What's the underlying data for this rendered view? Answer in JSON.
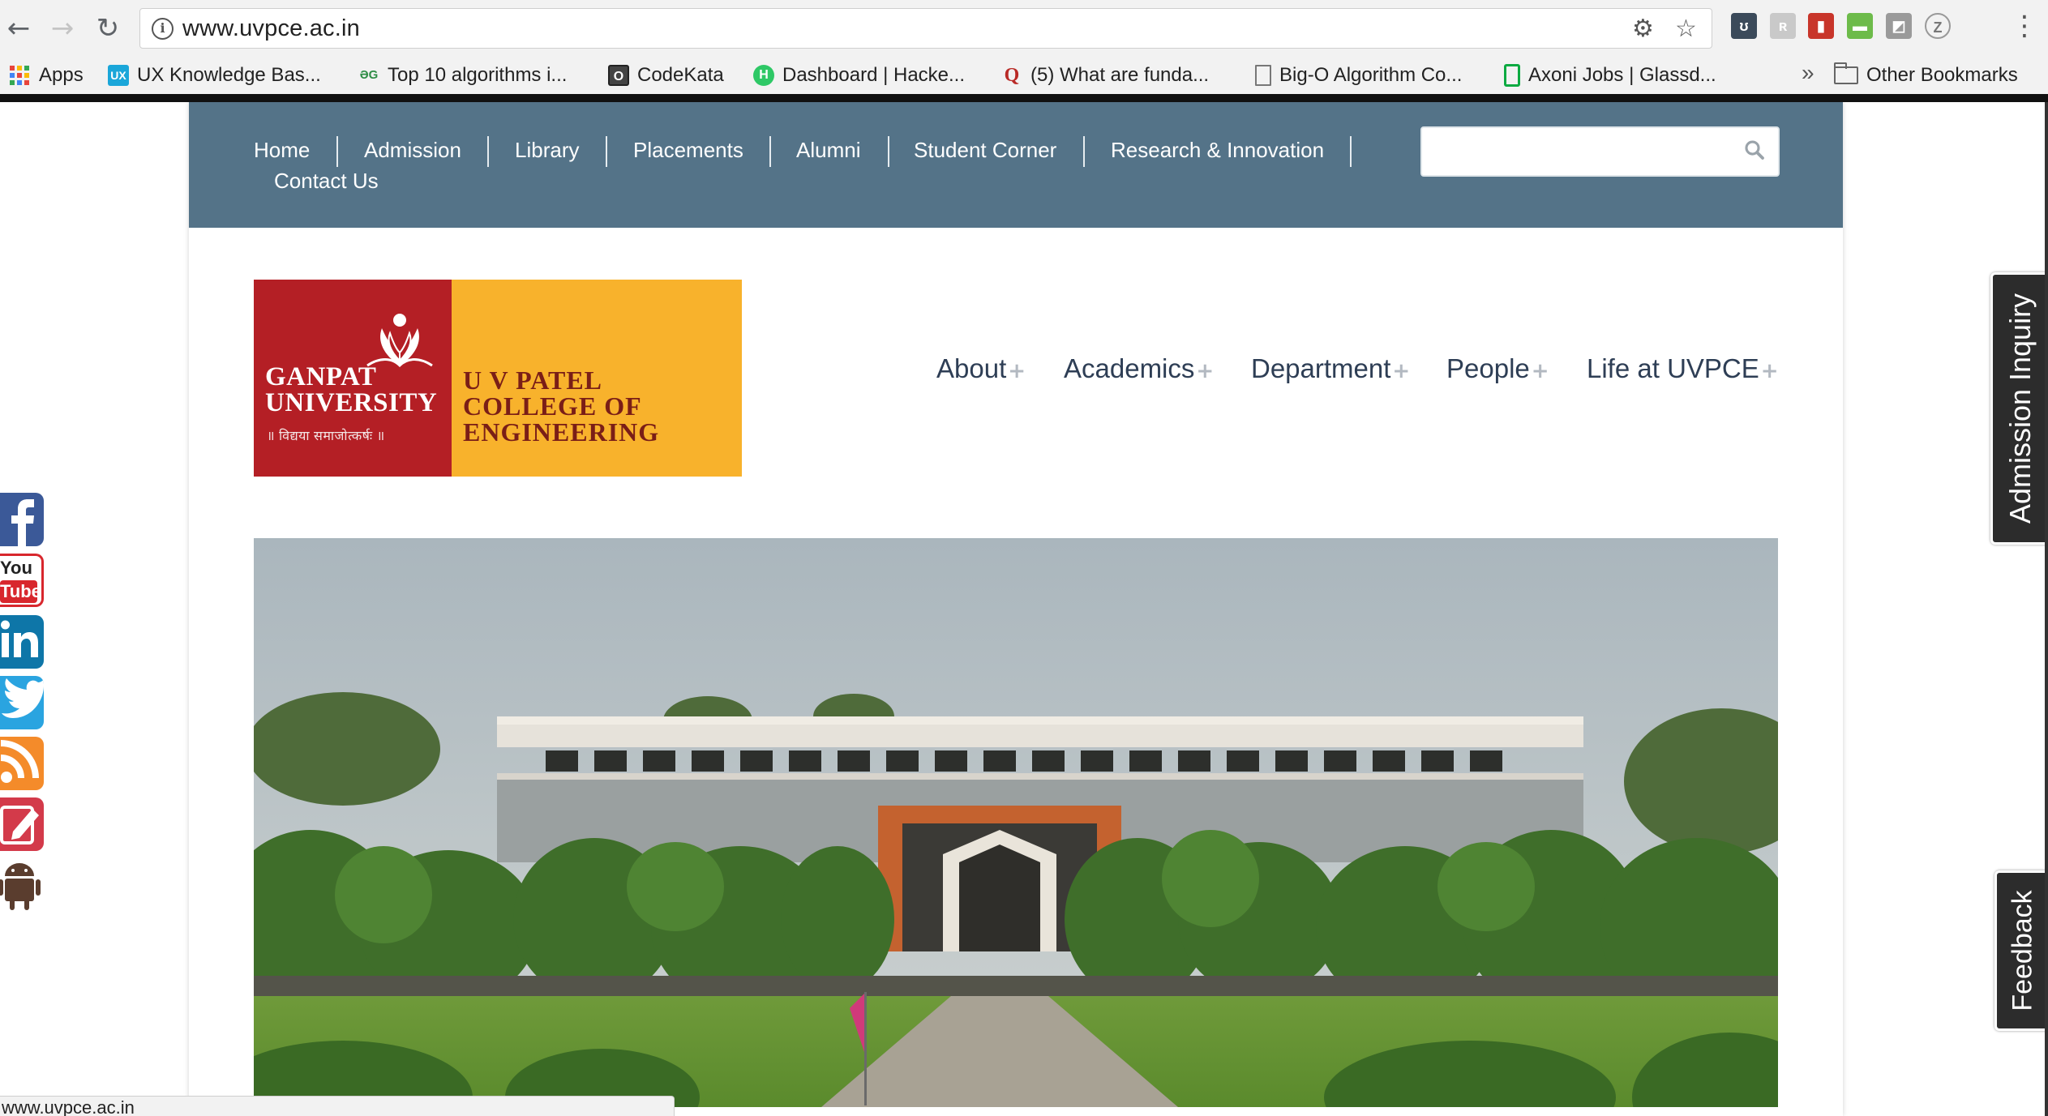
{
  "browser": {
    "url": "www.uvpce.ac.in",
    "bookmarks": [
      {
        "label": "Apps",
        "icon": "apps-grid-icon"
      },
      {
        "label": "UX Knowledge Bas...",
        "icon": "ux-icon",
        "icon_text": "UX"
      },
      {
        "label": "Top 10 algorithms i...",
        "icon": "geeksforgeeks-icon",
        "icon_text": "ƏG"
      },
      {
        "label": "CodeKata",
        "icon": "codekata-icon",
        "icon_text": "O"
      },
      {
        "label": "Dashboard | Hacke...",
        "icon": "hackerrank-icon",
        "icon_text": "H"
      },
      {
        "label": "(5) What are funda...",
        "icon": "quora-icon",
        "icon_text": "Q"
      },
      {
        "label": "Big-O Algorithm Co...",
        "icon": "page-icon"
      },
      {
        "label": "Axoni Jobs | Glassd...",
        "icon": "glassdoor-icon"
      },
      {
        "label": "Other Bookmarks",
        "icon": "folder-icon"
      }
    ],
    "more_bookmarks": "»",
    "status_url": "www.uvpce.ac.in"
  },
  "topnav": {
    "items": [
      "Home",
      "Admission",
      "Library",
      "Placements",
      "Alumni",
      "Student Corner",
      "Research & Innovation",
      "Contact Us"
    ],
    "search_placeholder": ""
  },
  "logo": {
    "university": "GANPAT\nUNIVERSITY",
    "motto": "॥ विद्यया समाजोत्कर्षः ॥",
    "college": "U V PATEL\nCOLLEGE OF\nENGINEERING"
  },
  "mainnav": {
    "items": [
      "About",
      "Academics",
      "Department",
      "People",
      "Life at UVPCE"
    ],
    "expand_symbol": "+"
  },
  "social": [
    "facebook-icon",
    "youtube-icon",
    "linkedin-icon",
    "twitter-icon",
    "rss-icon",
    "blog-icon",
    "android-icon"
  ],
  "social_youtube_text": {
    "line1": "You",
    "line2": "Tube"
  },
  "side_tabs": {
    "admission": "Admission Inquiry",
    "feedback": "Feedback"
  },
  "colors": {
    "nav_bg": "#547388",
    "logo_red": "#b41f25",
    "logo_yellow": "#f8b22c",
    "menu_text": "#2e3e55"
  }
}
